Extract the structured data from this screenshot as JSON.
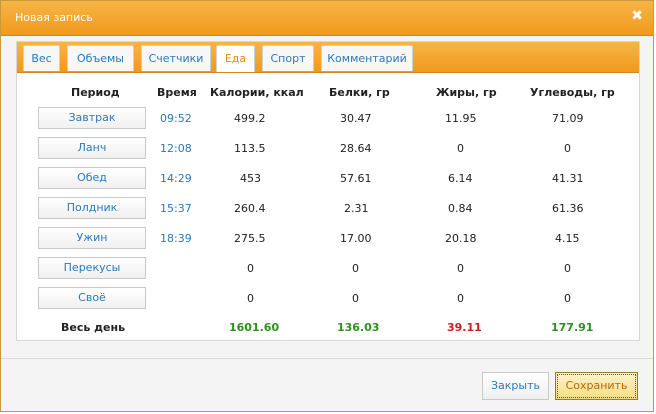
{
  "dialog": {
    "title": "Новая запись"
  },
  "tabs": [
    "Вес",
    "Объемы",
    "Счетчики",
    "Еда",
    "Спорт",
    "Комментарий"
  ],
  "active_tab": "Еда",
  "columns": [
    "Период",
    "Время",
    "Калории, ккал",
    "Белки, гр",
    "Жиры, гр",
    "Углеводы, гр"
  ],
  "meals": [
    {
      "period": "Завтрак",
      "time": "09:52",
      "calories": "499.2",
      "protein": "30.47",
      "fat": "11.95",
      "carbs": "71.09"
    },
    {
      "period": "Ланч",
      "time": "12:08",
      "calories": "113.5",
      "protein": "28.64",
      "fat": "0",
      "carbs": "0"
    },
    {
      "period": "Обед",
      "time": "14:29",
      "calories": "453",
      "protein": "57.61",
      "fat": "6.14",
      "carbs": "41.31"
    },
    {
      "period": "Полдник",
      "time": "15:37",
      "calories": "260.4",
      "protein": "2.31",
      "fat": "0.84",
      "carbs": "61.36"
    },
    {
      "period": "Ужин",
      "time": "18:39",
      "calories": "275.5",
      "protein": "17.00",
      "fat": "20.18",
      "carbs": "4.15"
    },
    {
      "period": "Перекусы",
      "time": "",
      "calories": "0",
      "protein": "0",
      "fat": "0",
      "carbs": "0"
    },
    {
      "period": "Своё",
      "time": "",
      "calories": "0",
      "protein": "0",
      "fat": "0",
      "carbs": "0"
    }
  ],
  "total": {
    "label": "Весь день",
    "calories": "1601.60",
    "protein": "136.03",
    "fat": "39.11",
    "carbs": "177.91"
  },
  "buttons": {
    "close": "Закрыть",
    "save": "Сохранить"
  },
  "colors": {
    "accent": "#ef9a1c",
    "link": "#2a79b8",
    "total_ok": "#2f8f1f",
    "total_warn": "#c82020"
  }
}
